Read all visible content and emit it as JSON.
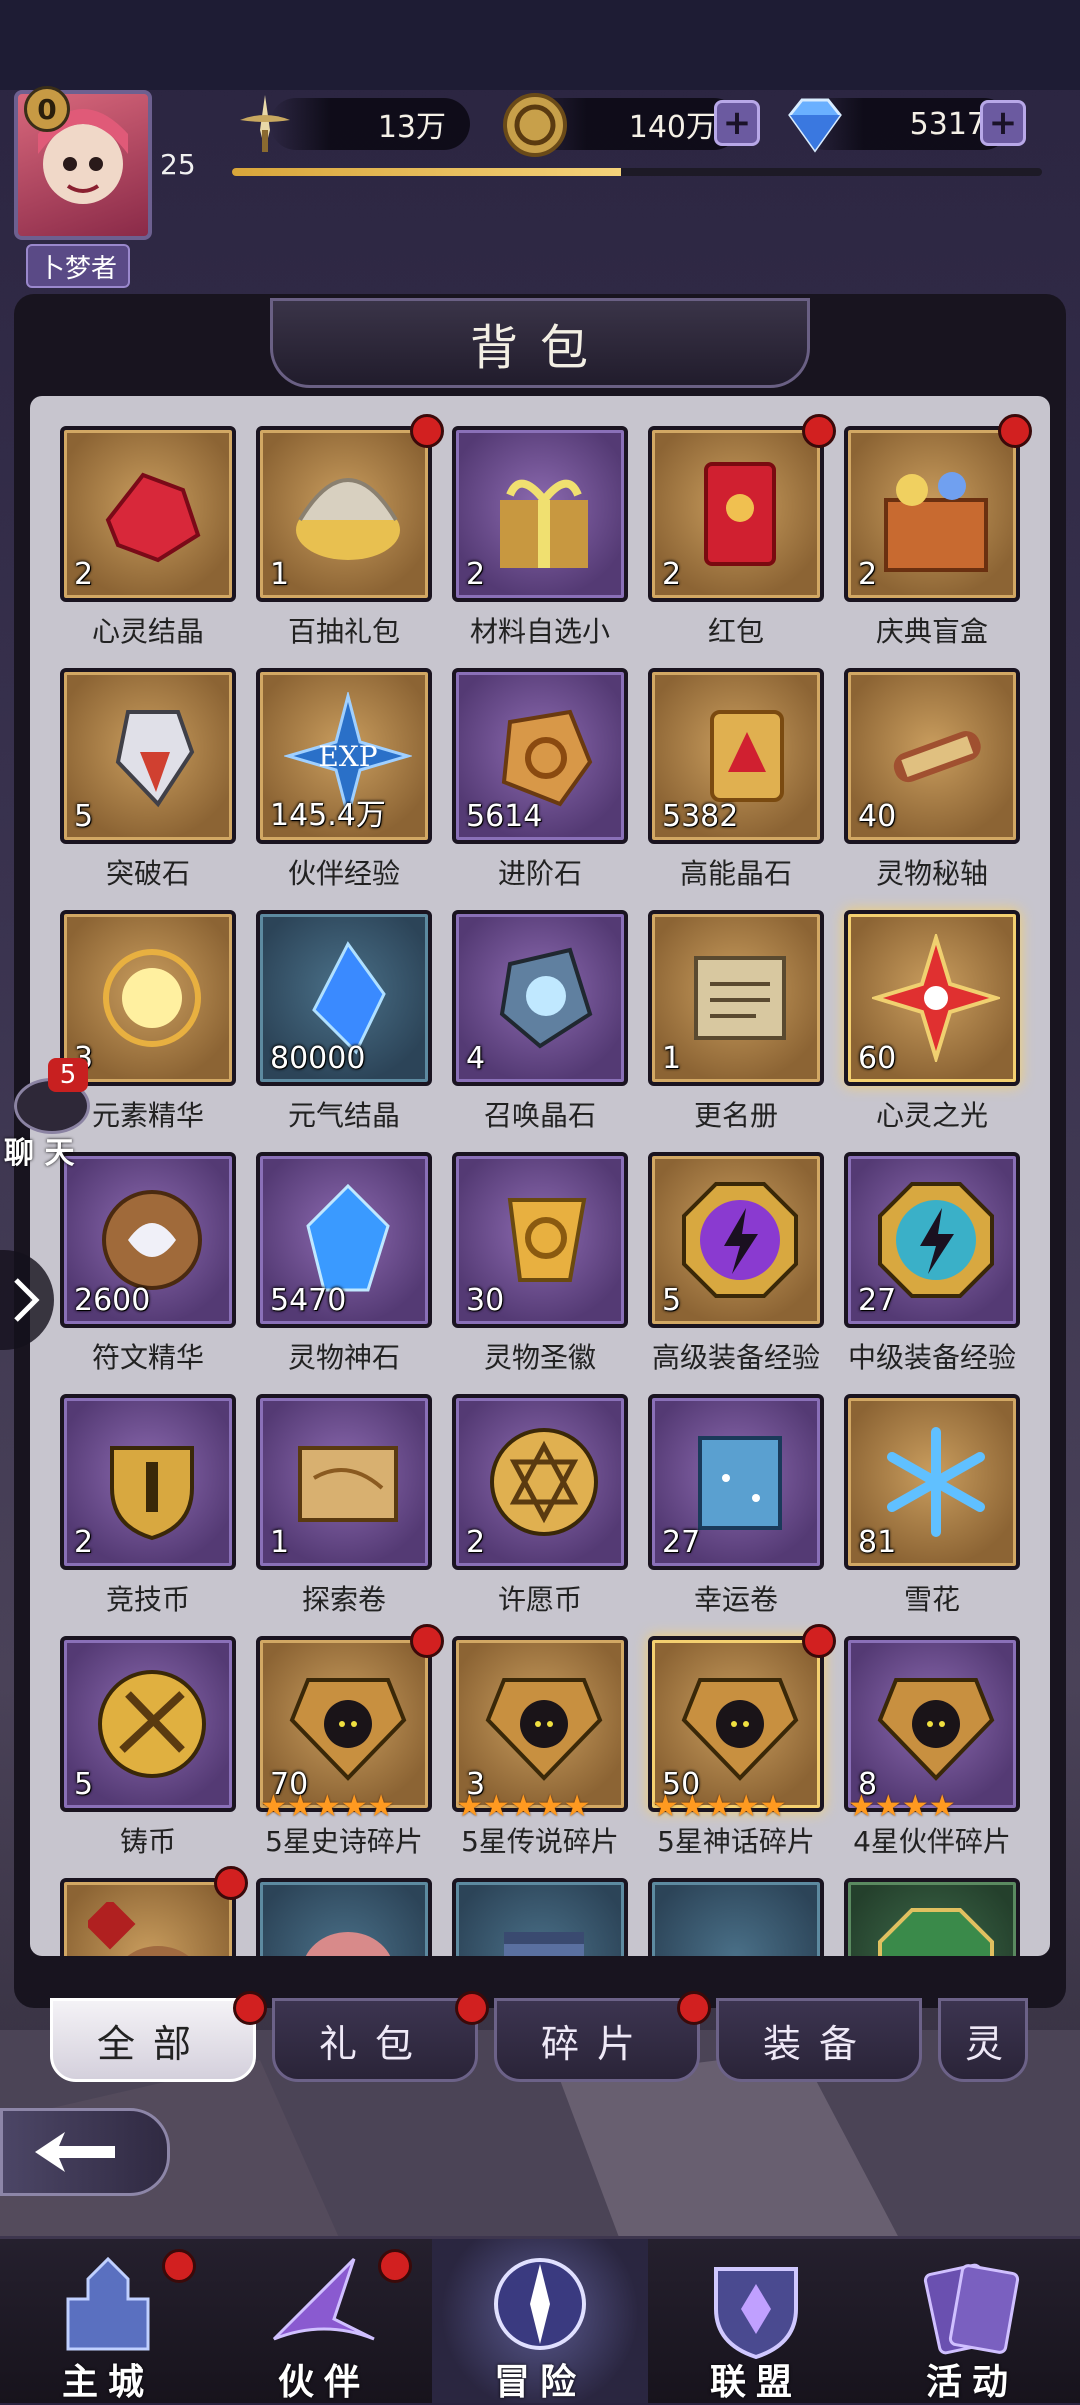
{
  "player": {
    "rank_badge": "0",
    "title": "卜梦者",
    "level": "25",
    "xp_fraction": 0.48
  },
  "resources": {
    "power": "13万",
    "gold": "140万",
    "diamond": "5317"
  },
  "panel": {
    "title": "背包"
  },
  "chat": {
    "badge": "5",
    "label": "聊 天"
  },
  "items": [
    {
      "name": "心灵结晶",
      "count": "2",
      "frame": "gold",
      "art": "red-crystal",
      "dot": false
    },
    {
      "name": "百抽礼包",
      "count": "1",
      "frame": "gold",
      "art": "gold-shell",
      "dot": true
    },
    {
      "name": "材料自选小",
      "count": "2",
      "frame": "purple",
      "art": "gift-box",
      "dot": false
    },
    {
      "name": "红包",
      "count": "2",
      "frame": "gold",
      "art": "red-envelope",
      "dot": true
    },
    {
      "name": "庆典盲盒",
      "count": "2",
      "frame": "gold",
      "art": "mystery-box",
      "dot": true
    },
    {
      "name": "突破石",
      "count": "5",
      "frame": "gold",
      "art": "breakthrough-stone",
      "dot": false
    },
    {
      "name": "伙伴经验",
      "count": "145.4万",
      "frame": "gold",
      "art": "exp-star",
      "dot": false
    },
    {
      "name": "进阶石",
      "count": "5614",
      "frame": "purple",
      "art": "advance-stone",
      "dot": false
    },
    {
      "name": "高能晶石",
      "count": "5382",
      "frame": "gold",
      "art": "energy-crystal",
      "dot": false
    },
    {
      "name": "灵物秘轴",
      "count": "40",
      "frame": "gold",
      "art": "scroll",
      "dot": false
    },
    {
      "name": "元素精华",
      "count": "3",
      "frame": "gold",
      "art": "element-essence",
      "dot": false
    },
    {
      "name": "元气结晶",
      "count": "80000",
      "frame": "blue",
      "art": "blue-crystal",
      "dot": false
    },
    {
      "name": "召唤晶石",
      "count": "4",
      "frame": "purple",
      "art": "summon-stone",
      "dot": false
    },
    {
      "name": "更名册",
      "count": "1",
      "frame": "gold",
      "art": "rename-book",
      "dot": false
    },
    {
      "name": "心灵之光",
      "count": "60",
      "frame": "gold",
      "art": "spirit-light",
      "dot": false,
      "glow": true
    },
    {
      "name": "符文精华",
      "count": "2600",
      "frame": "purple",
      "art": "rune-essence",
      "dot": false
    },
    {
      "name": "灵物神石",
      "count": "5470",
      "frame": "purple",
      "art": "blue-gem",
      "dot": false
    },
    {
      "name": "灵物圣徽",
      "count": "30",
      "frame": "purple",
      "art": "holy-emblem",
      "dot": false
    },
    {
      "name": "高级装备经验",
      "count": "5",
      "frame": "gold",
      "art": "equip-exp-purple",
      "dot": false
    },
    {
      "name": "中级装备经验",
      "count": "27",
      "frame": "purple",
      "art": "equip-exp-teal",
      "dot": false
    },
    {
      "name": "竞技币",
      "count": "2",
      "frame": "purple",
      "art": "arena-coin",
      "dot": false
    },
    {
      "name": "探索卷",
      "count": "1",
      "frame": "purple",
      "art": "explore-scroll",
      "dot": false
    },
    {
      "name": "许愿币",
      "count": "2",
      "frame": "purple",
      "art": "wish-coin",
      "dot": false
    },
    {
      "name": "幸运卷",
      "count": "27",
      "frame": "purple",
      "art": "luck-scroll",
      "dot": false
    },
    {
      "name": "雪花",
      "count": "81",
      "frame": "gold",
      "art": "snowflake",
      "dot": false
    },
    {
      "name": "铸币",
      "count": "5",
      "frame": "purple",
      "art": "mint-coin",
      "dot": false
    },
    {
      "name": "5星史诗碎片",
      "count": "70",
      "frame": "gold",
      "art": "hero-shard",
      "dot": true,
      "stars": 5
    },
    {
      "name": "5星传说碎片",
      "count": "3",
      "frame": "gold",
      "art": "hero-shard",
      "dot": false,
      "stars": 5
    },
    {
      "name": "5星神话碎片",
      "count": "50",
      "frame": "gold",
      "art": "hero-shard",
      "dot": true,
      "stars": 5,
      "glow": true
    },
    {
      "name": "4星伙伴碎片",
      "count": "8",
      "frame": "purple",
      "art": "hero-shard",
      "dot": false,
      "stars": 4
    },
    {
      "name": "",
      "count": "",
      "frame": "gold",
      "art": "fire-pouch",
      "dot": true
    },
    {
      "name": "",
      "count": "",
      "frame": "blue",
      "art": "hair",
      "dot": false
    },
    {
      "name": "",
      "count": "",
      "frame": "blue",
      "art": "pants",
      "dot": false
    },
    {
      "name": "",
      "count": "",
      "frame": "blue",
      "art": "beads",
      "dot": false
    },
    {
      "name": "",
      "count": "",
      "frame": "green",
      "art": "green-emblem",
      "dot": false
    }
  ],
  "tabs": [
    {
      "label": "全部",
      "active": true,
      "dot": true
    },
    {
      "label": "礼包",
      "active": false,
      "dot": true
    },
    {
      "label": "碎片",
      "active": false,
      "dot": true
    },
    {
      "label": "装备",
      "active": false,
      "dot": false
    },
    {
      "label": "灵",
      "active": false,
      "dot": false
    }
  ],
  "nav": [
    {
      "label": "主城",
      "icon": "castle-icon",
      "dot": true,
      "active": false
    },
    {
      "label": "伙伴",
      "icon": "witch-hat-icon",
      "dot": true,
      "active": false
    },
    {
      "label": "冒险",
      "icon": "compass-icon",
      "dot": false,
      "active": true
    },
    {
      "label": "联盟",
      "icon": "shield-crest-icon",
      "dot": false,
      "active": false
    },
    {
      "label": "活动",
      "icon": "cards-icon",
      "dot": false,
      "active": false
    }
  ],
  "colors": {
    "gold_frame": "#b8894a",
    "purple_frame": "#6a4a90",
    "red_dot": "#d22020",
    "xp_fill": "#e8bd55"
  }
}
